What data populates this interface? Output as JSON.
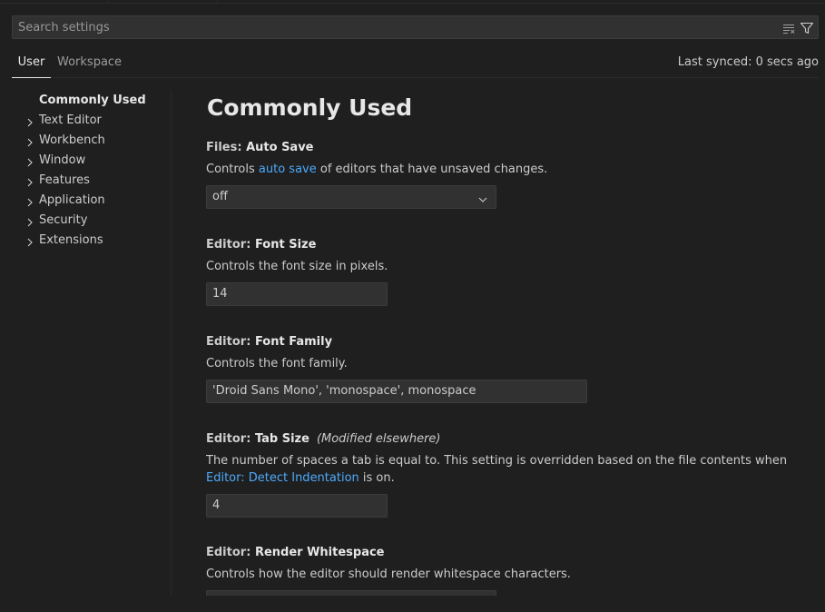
{
  "search": {
    "placeholder": "Search settings"
  },
  "tabs": {
    "user": "User",
    "workspace": "Workspace",
    "sync_status": "Last synced: 0 secs ago"
  },
  "toc": [
    {
      "label": "Commonly Used",
      "active": true,
      "expandable": false
    },
    {
      "label": "Text Editor",
      "expandable": true
    },
    {
      "label": "Workbench",
      "expandable": true
    },
    {
      "label": "Window",
      "expandable": true
    },
    {
      "label": "Features",
      "expandable": true
    },
    {
      "label": "Application",
      "expandable": true
    },
    {
      "label": "Security",
      "expandable": true
    },
    {
      "label": "Extensions",
      "expandable": true
    }
  ],
  "section_title": "Commonly Used",
  "settings": [
    {
      "category": "Files: ",
      "name": "Auto Save",
      "desc_before": "Controls ",
      "desc_link": "auto save",
      "desc_after": " of editors that have unsaved changes.",
      "control": "dropdown",
      "value": "off"
    },
    {
      "category": "Editor: ",
      "name": "Font Size",
      "desc": "Controls the font size in pixels.",
      "control": "input",
      "value": "14"
    },
    {
      "category": "Editor: ",
      "name": "Font Family",
      "desc": "Controls the font family.",
      "control": "input",
      "value": "'Droid Sans Mono', 'monospace', monospace"
    },
    {
      "category": "Editor: ",
      "name": "Tab Size",
      "modified": "(Modified elsewhere)",
      "desc_before": "The number of spaces a tab is equal to. This setting is overridden based on the file contents when ",
      "desc_link": "Editor: Detect Indentation",
      "desc_after": " is on.",
      "control": "input",
      "value": "4"
    },
    {
      "category": "Editor: ",
      "name": "Render Whitespace",
      "desc": "Controls how the editor should render whitespace characters.",
      "control": "dropdown"
    }
  ],
  "colors": {
    "background": "#1f1f1f",
    "link": "#4daafc",
    "input_bg": "#313131",
    "border": "#3c3c3c"
  },
  "icons": {
    "clear": "clear-filter-icon",
    "filter": "filter-icon",
    "chevron": "chevron-right-icon",
    "dropdown": "chevron-down-icon"
  }
}
